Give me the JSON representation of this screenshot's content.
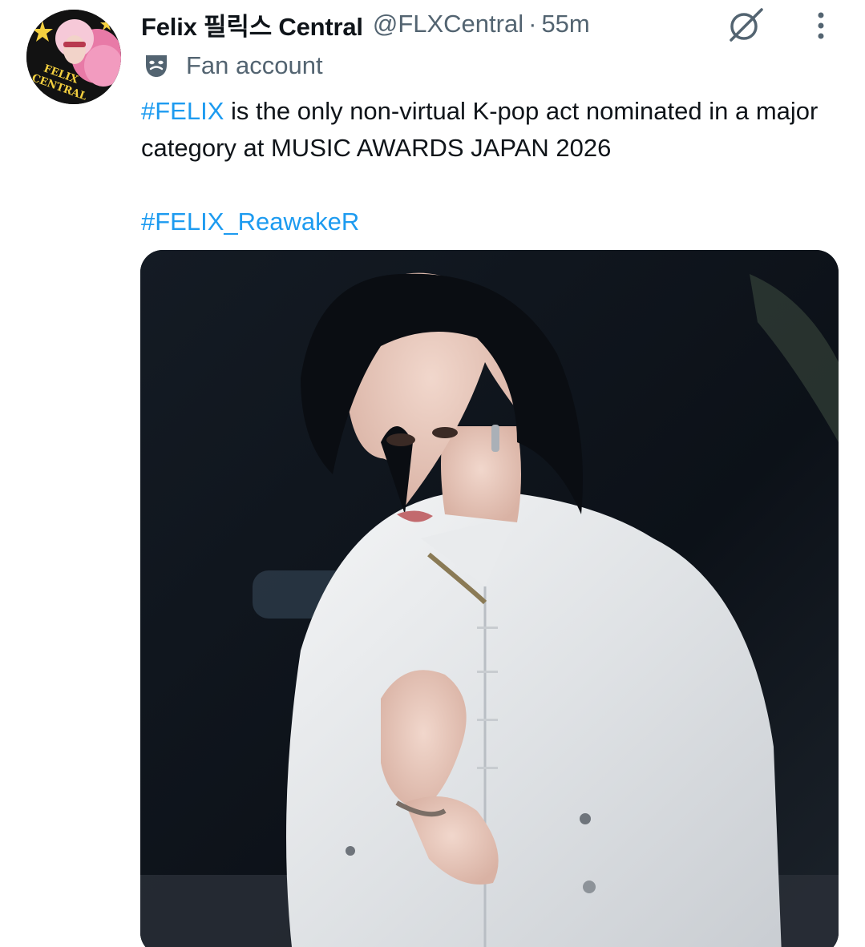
{
  "author": {
    "display_name": "Felix 필릭스 Central",
    "handle": "@FLXCentral",
    "separator": "·",
    "time": "55m",
    "label": "Fan account",
    "avatar_text": "FELIX CENTRAL",
    "avatar_icon": "profile-photo"
  },
  "icons": {
    "grok": "grok-icon",
    "more": "more-icon",
    "label": "theater-mask-icon"
  },
  "tweet": {
    "hashtag_main": "#FELIX",
    "body": " is the only non-virtual K-pop act nominated in a major category at MUSIC AWARDS JAPAN 2026",
    "hashtag_second": "#FELIX_ReawakeR"
  },
  "colors": {
    "link": "#1d9bf0",
    "secondary_text": "#536471",
    "primary_text": "#0f1419"
  }
}
